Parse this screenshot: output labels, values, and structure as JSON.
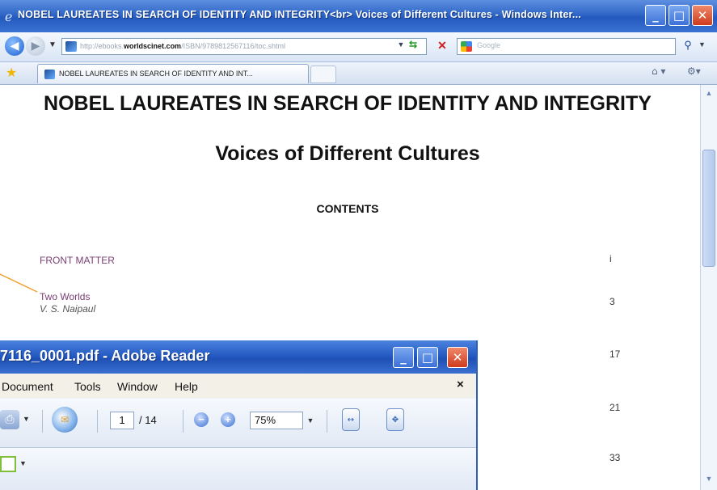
{
  "browser": {
    "title": "NOBEL LAUREATES IN SEARCH OF IDENTITY AND INTEGRITY<br> Voices of Different Cultures - Windows Inter...",
    "address": {
      "prefix": "http://ebooks.",
      "domain": "worldscinet.com",
      "suffix": "/ISBN/9789812567116/toc.shtml"
    },
    "search_placeholder": "Google",
    "tab_label": "NOBEL LAUREATES IN SEARCH OF IDENTITY AND INT...",
    "icons": {
      "back": "back-arrow-icon",
      "forward": "forward-arrow-icon",
      "refresh": "refresh-icon",
      "stop": "stop-icon",
      "search": "magnifier-icon",
      "favorites": "star-icon",
      "home": "home-icon",
      "tools": "gear-icon"
    }
  },
  "page": {
    "title": "NOBEL LAUREATES IN SEARCH OF IDENTITY AND INTEGRITY",
    "subtitle": "Voices of Different Cultures",
    "contents_heading": "CONTENTS",
    "toc": [
      {
        "label": "FRONT MATTER",
        "author": "",
        "page": "i"
      },
      {
        "label": "Two Worlds",
        "author": "V. S. Naipaul",
        "page": "3"
      }
    ],
    "extra_page_numbers": [
      "17",
      "21",
      "33"
    ]
  },
  "reader": {
    "title": "7116_0001.pdf - Adobe Reader",
    "menu": {
      "document": "Document",
      "tools": "Tools",
      "window": "Window",
      "help": "Help",
      "close": "×"
    },
    "toolbar": {
      "page_current": "1",
      "page_total": "/ 14",
      "zoom": "75%"
    },
    "accent": "#2257c0"
  }
}
